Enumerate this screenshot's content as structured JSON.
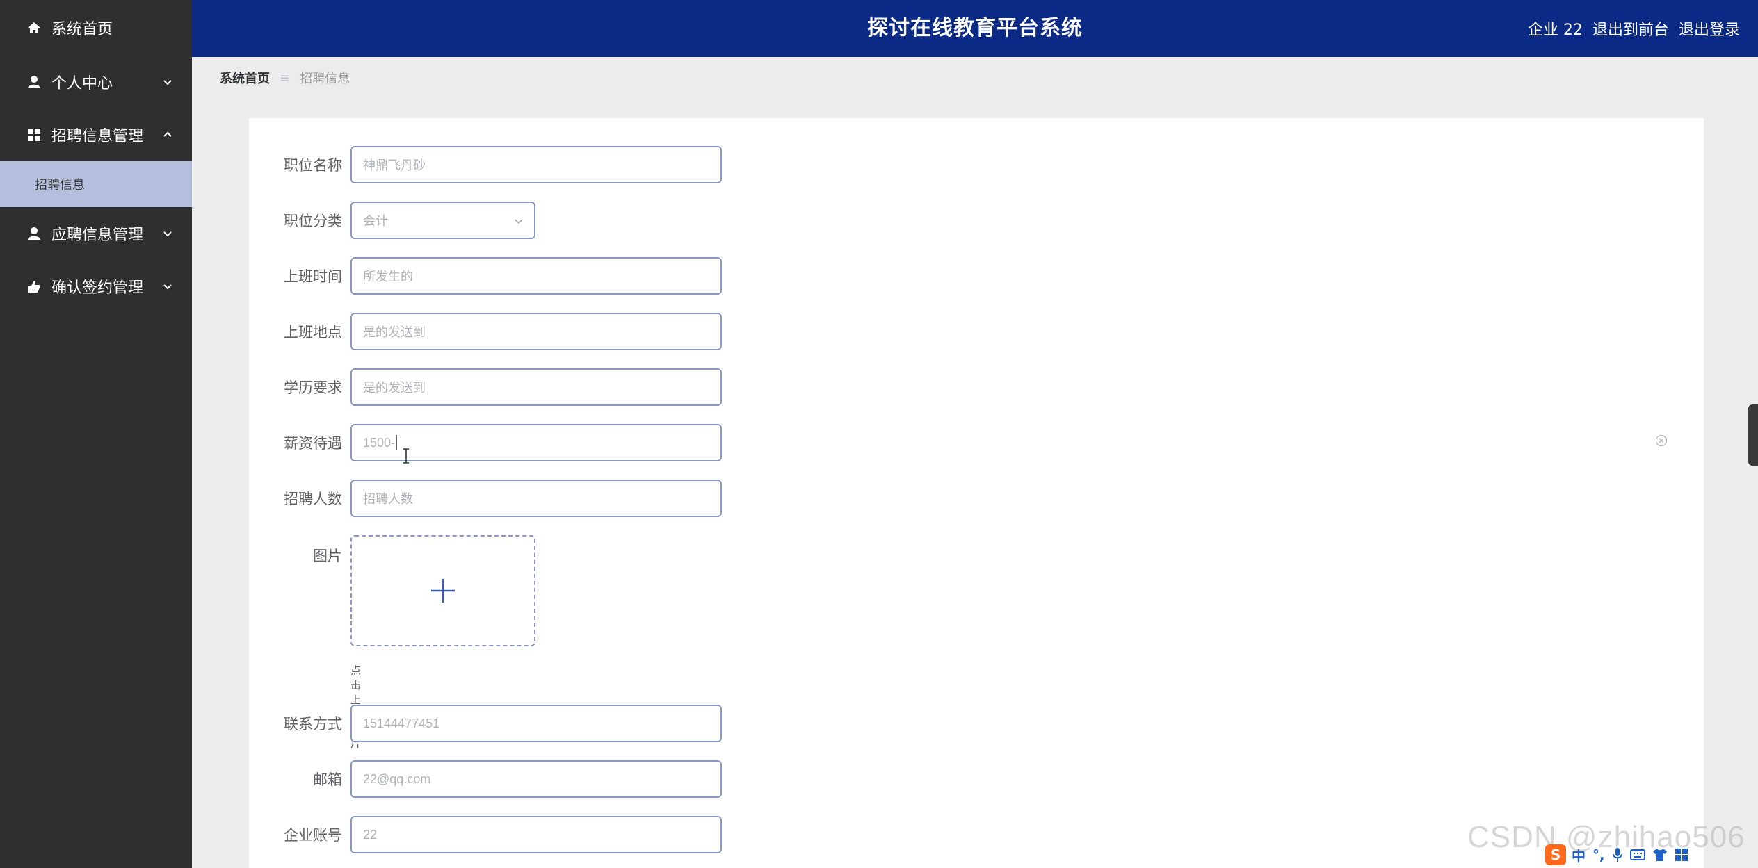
{
  "sidebar": {
    "items": [
      {
        "label": "系统首页",
        "icon": "home-icon"
      },
      {
        "label": "个人中心",
        "icon": "user-icon"
      },
      {
        "label": "招聘信息管理",
        "icon": "grid-icon"
      },
      {
        "label": "应聘信息管理",
        "icon": "user-icon"
      },
      {
        "label": "确认签约管理",
        "icon": "hand-icon"
      }
    ],
    "submenu": {
      "label": "招聘信息"
    }
  },
  "header": {
    "title": "探讨在线教育平台系统",
    "username": "企业 22",
    "to_front_label": "退出到前台",
    "logout_label": "退出登录"
  },
  "breadcrumb": {
    "home": "系统首页",
    "separator": "≡",
    "current": "招聘信息"
  },
  "form": {
    "job_name": {
      "label": "职位名称",
      "value": "神鼎飞丹砂"
    },
    "job_category": {
      "label": "职位分类",
      "value": "会计"
    },
    "work_time": {
      "label": "上班时间",
      "value": "所发生的"
    },
    "work_place": {
      "label": "上班地点",
      "value": "是的发送到"
    },
    "education": {
      "label": "学历要求",
      "value": "是的发送到"
    },
    "salary": {
      "label": "薪资待遇",
      "value": "1500-"
    },
    "headcount": {
      "label": "招聘人数",
      "placeholder": "招聘人数"
    },
    "picture": {
      "label": "图片",
      "hint": "点击上传图片"
    },
    "contact": {
      "label": "联系方式",
      "value": "15144477451"
    },
    "email": {
      "label": "邮箱",
      "value": "22@qq.com"
    },
    "company_account": {
      "label": "企业账号",
      "value": "22"
    }
  },
  "overlay": {
    "watermark": "CSDN @zhihao506",
    "ime_logo": "S",
    "ime_mode": "中",
    "ime_punct": "°,"
  },
  "colors": {
    "sidebar_bg": "#2f2f2f",
    "header_bg": "#0a2a85",
    "submenu_active_bg": "#b3bfdc",
    "input_border": "#8a98c8"
  }
}
